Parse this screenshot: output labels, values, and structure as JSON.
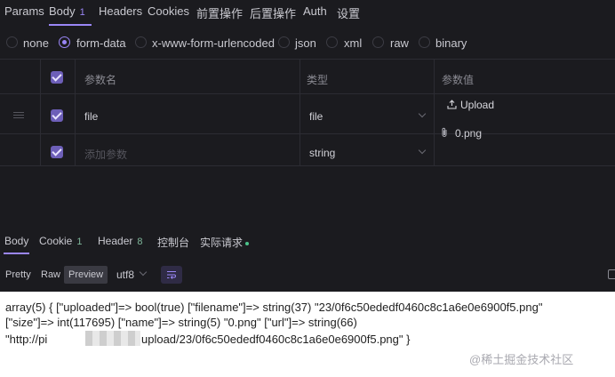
{
  "request_tabs": [
    {
      "label": "Params"
    },
    {
      "label": "Body",
      "count": "1"
    },
    {
      "label": "Headers"
    },
    {
      "label": "Cookies"
    },
    {
      "label": "前置操作"
    },
    {
      "label": "后置操作"
    },
    {
      "label": "Auth"
    },
    {
      "label": "设置"
    }
  ],
  "body_types": [
    "none",
    "form-data",
    "x-www-form-urlencoded",
    "json",
    "xml",
    "raw",
    "binary"
  ],
  "body_type_selected": "form-data",
  "table": {
    "headers": {
      "name": "参数名",
      "type": "类型",
      "value": "参数值"
    },
    "rows": [
      {
        "name": "file",
        "type": "file",
        "upload_label": "Upload",
        "file_name": "0.png"
      },
      {
        "name_placeholder": "添加参数",
        "type": "string"
      }
    ]
  },
  "response_tabs": [
    {
      "label": "Body"
    },
    {
      "label": "Cookie",
      "count": "1"
    },
    {
      "label": "Header",
      "count": "8"
    },
    {
      "label": "控制台"
    },
    {
      "label": "实际请求"
    }
  ],
  "view_modes": [
    "Pretty",
    "Raw",
    "Preview"
  ],
  "view_mode_selected": "Preview",
  "encoding": "utf8",
  "output_lines": [
    "array(5) { [\"uploaded\"]=> bool(true) [\"filename\"]=> string(37) \"23/0f6c50ededf0460c8c1a6e0e6900f5.png\"",
    "[\"size\"]=> int(117695) [\"name\"]=> string(5) \"0.png\" [\"url\"]=> string(66)",
    "\"http://pi",
    "upload/23/0f6c50ededf0460c8c1a6e0e6900f5.png\" }"
  ],
  "watermark": "@稀土掘金技术社区",
  "colors": {
    "accent": "#9a86f6",
    "background": "#1b1b1f",
    "output_bg": "#ffffff"
  }
}
